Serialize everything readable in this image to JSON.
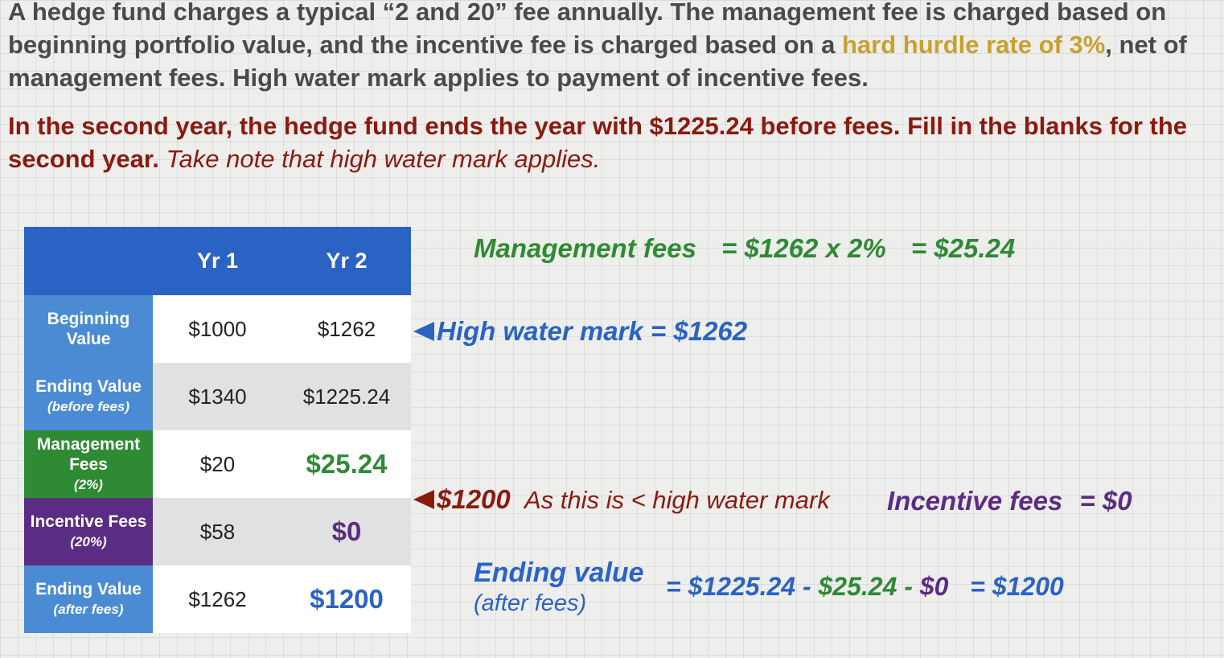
{
  "intro": {
    "part1": "A hedge fund charges a typical “2 and 20” fee annually.  The management fee is charged based on beginning portfolio value, and the incentive fee is charged based on a ",
    "highlight": "hard hurdle rate of 3%",
    "part2": ", net of management fees.  High water mark applies to payment of incentive fees."
  },
  "task": {
    "text": "In the second year, the hedge fund ends the year with $1225.24 before fees.  Fill in the blanks for the second year.",
    "note": "Take note that high water mark applies."
  },
  "table": {
    "headers": [
      "",
      "Yr 1",
      "Yr 2"
    ],
    "rows": [
      {
        "label": "Beginning Value",
        "sub": "",
        "yr1": "$1000",
        "yr2": "$1262"
      },
      {
        "label": "Ending Value",
        "sub": "(before fees)",
        "yr1": "$1340",
        "yr2": "$1225.24"
      },
      {
        "label": "Management Fees",
        "sub": "(2%)",
        "yr1": "$20",
        "yr2": "$25.24"
      },
      {
        "label": "Incentive Fees",
        "sub": "(20%)",
        "yr1": "$58",
        "yr2": "$0"
      },
      {
        "label": "Ending Value",
        "sub": "(after fees)",
        "yr1": "$1262",
        "yr2": "$1200"
      }
    ]
  },
  "annotations": {
    "mgmt_label": "Management fees",
    "mgmt_calc": "= $1262 x 2%",
    "mgmt_result": "= $25.24",
    "hwm": "High water mark = $1262",
    "incentive_value": "$1200",
    "incentive_reason": "As this is < high water mark",
    "incentive_label": "Incentive fees",
    "incentive_result": "= $0",
    "ending_label": "Ending value",
    "ending_sub": "(after fees)",
    "ending_eq": "= $1225.24 -",
    "ending_mgmt": "$25.24 -",
    "ending_inc": "$0",
    "ending_result": "= $1200"
  },
  "colors": {
    "header_blue": "#2a63c4",
    "label_blue": "#4a8bd4",
    "green": "#2f8a34",
    "purple": "#5b2c83",
    "dark_red": "#8b1a0e",
    "gold": "#c9a030"
  }
}
